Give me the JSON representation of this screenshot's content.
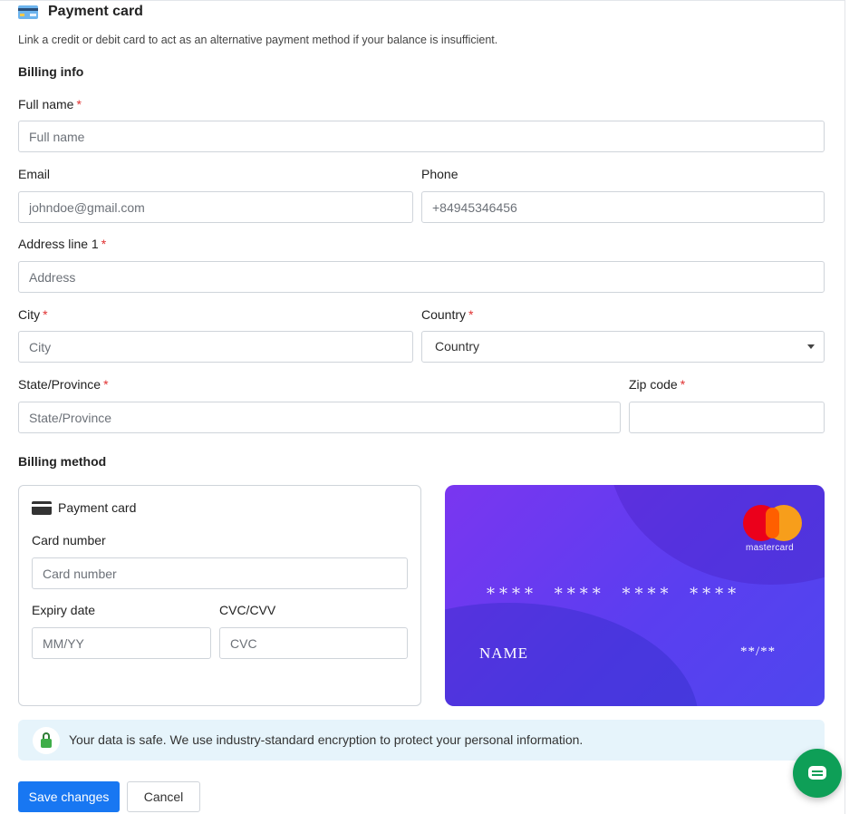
{
  "header": {
    "title": "Payment card",
    "description": "Link a credit or debit card to act as an alternative payment method if your balance is insufficient."
  },
  "billing_info": {
    "title": "Billing info",
    "full_name": {
      "label": "Full name",
      "placeholder": "Full name"
    },
    "email": {
      "label": "Email",
      "placeholder": "johndoe@gmail.com"
    },
    "phone": {
      "label": "Phone",
      "placeholder": "+84945346456"
    },
    "address": {
      "label": "Address line 1",
      "placeholder": "Address"
    },
    "city": {
      "label": "City",
      "placeholder": "City"
    },
    "country": {
      "label": "Country",
      "value": "Country"
    },
    "state": {
      "label": "State/Province",
      "placeholder": "State/Province"
    },
    "zip": {
      "label": "Zip code",
      "placeholder": ""
    },
    "required_mark": "*"
  },
  "billing_method": {
    "title": "Billing method",
    "method_label": "Payment card",
    "card_number": {
      "label": "Card number",
      "placeholder": "Card number"
    },
    "expiry": {
      "label": "Expiry date",
      "placeholder": "MM/YY"
    },
    "cvc": {
      "label": "CVC/CVV",
      "placeholder": "CVC"
    }
  },
  "card_preview": {
    "brand": "mastercard",
    "number": "**** **** **** ****",
    "name": "NAME",
    "expiry": "**/**"
  },
  "notice": {
    "text": "Your data is safe. We use industry-standard encryption to protect your personal information."
  },
  "actions": {
    "save_label": "Save changes",
    "cancel_label": "Cancel"
  },
  "icons": {
    "title": "credit-card-icon",
    "method": "card-icon",
    "security": "lock-icon",
    "chat": "chat-icon"
  },
  "colors": {
    "primary": "#1877f2",
    "required": "#e03131",
    "card_gradient_start": "#7a36f0",
    "card_gradient_end": "#4f46ee",
    "notice_bg": "#e6f4fb",
    "chat_fab": "#0e9f57"
  }
}
